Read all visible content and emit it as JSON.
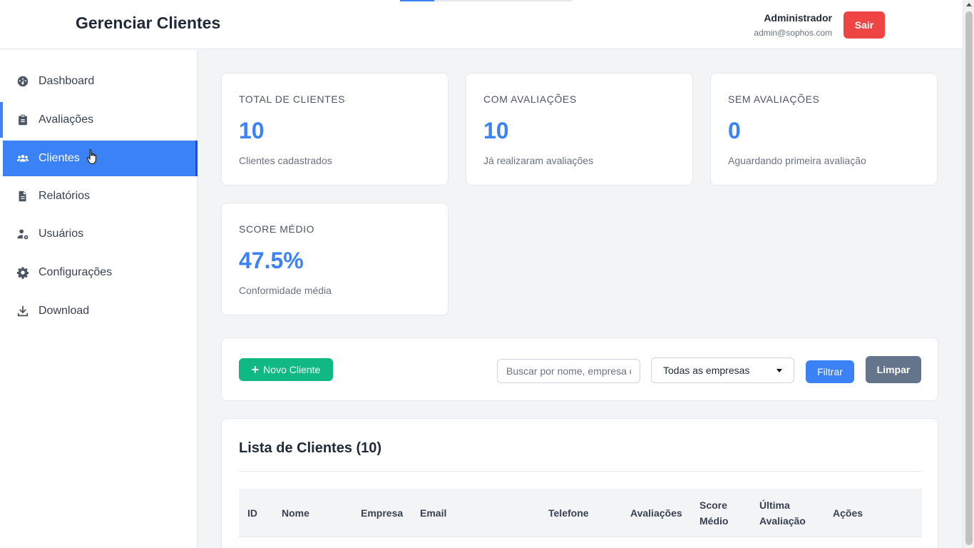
{
  "header": {
    "title": "Gerenciar Clientes",
    "user_name": "Administrador",
    "user_email": "admin@sophos.com",
    "logout_label": "Sair"
  },
  "sidebar": {
    "items": [
      {
        "label": "Dashboard",
        "icon": "dashboard-icon"
      },
      {
        "label": "Avaliações",
        "icon": "clipboard-icon"
      },
      {
        "label": "Clientes",
        "icon": "users-icon",
        "active": true
      },
      {
        "label": "Relatórios",
        "icon": "file-icon"
      },
      {
        "label": "Usuários",
        "icon": "user-gear-icon"
      },
      {
        "label": "Configurações",
        "icon": "gear-icon"
      },
      {
        "label": "Download",
        "icon": "download-icon"
      }
    ]
  },
  "stats": [
    {
      "label": "TOTAL DE CLIENTES",
      "value": "10",
      "sub": "Clientes cadastrados"
    },
    {
      "label": "COM AVALIAÇÕES",
      "value": "10",
      "sub": "Já realizaram avaliações"
    },
    {
      "label": "SEM AVALIAÇÕES",
      "value": "0",
      "sub": "Aguardando primeira avaliação"
    },
    {
      "label": "SCORE MÉDIO",
      "value": "47.5%",
      "sub": "Conformidade média"
    }
  ],
  "filters": {
    "new_label": "Novo Cliente",
    "search_placeholder": "Buscar por nome, empresa ou email",
    "company_select": "Todas as empresas",
    "filter_label": "Filtrar",
    "clear_label": "Limpar"
  },
  "list": {
    "title": "Lista de Clientes (10)",
    "columns": [
      "ID",
      "Nome",
      "Empresa",
      "Email",
      "Telefone",
      "Avaliações",
      "Score",
      "Médio",
      "Última",
      "Avaliação",
      "Ações"
    ]
  },
  "colors": {
    "primary": "#3b82f6",
    "success": "#10b981",
    "danger": "#ef4444",
    "secondary": "#64748b"
  }
}
